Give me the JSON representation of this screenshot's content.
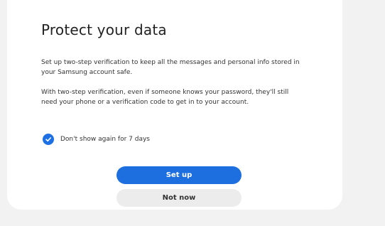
{
  "dialog": {
    "title": "Protect your data",
    "paragraph1": "Set up two-step verification to keep all the messages and personal info stored in your Samsung account safe.",
    "paragraph2": "With two-step verification, even if someone knows your password, they'll still need your phone or a verification code to get in to your account."
  },
  "checkbox": {
    "label": "Don't show again for 7 days",
    "checked": true
  },
  "buttons": {
    "primary_label": "Set up",
    "secondary_label": "Not now"
  },
  "colors": {
    "accent": "#1d6fe0",
    "secondary_button_bg": "#ececec",
    "page_bg": "#f2f2f2",
    "card_bg": "#ffffff"
  }
}
